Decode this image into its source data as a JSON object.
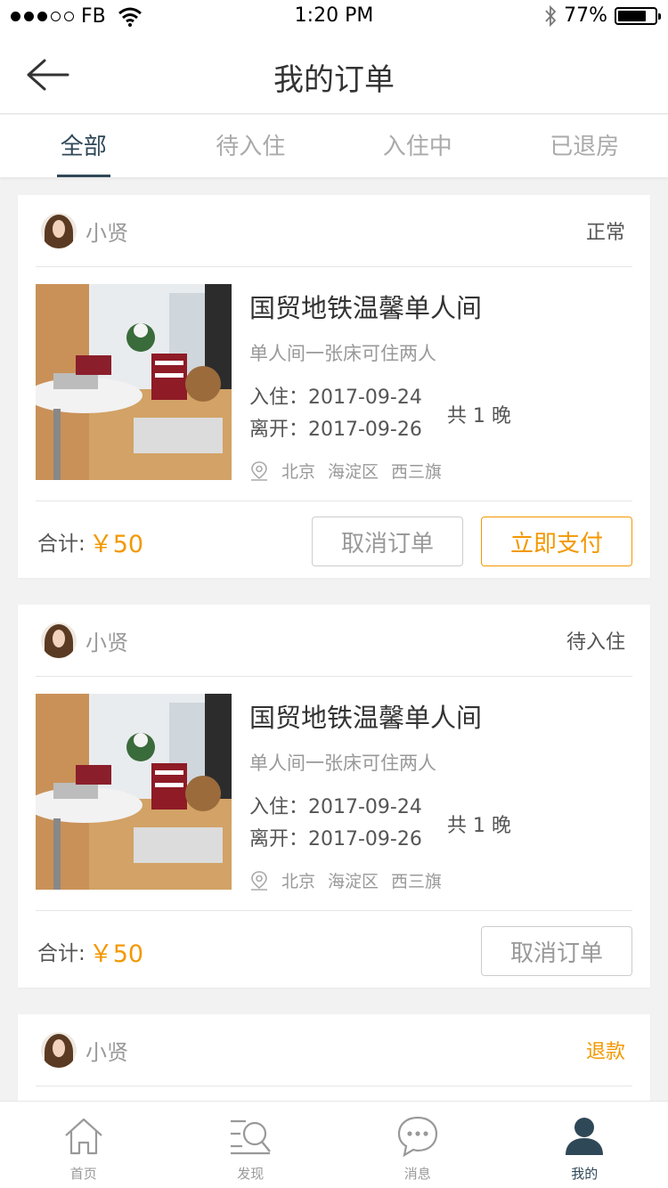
{
  "status_bar": {
    "carrier": "FB",
    "time": "1:20 PM",
    "battery": "77%",
    "battery_level": 0.77
  },
  "nav": {
    "title": "我的订单"
  },
  "tabs": [
    {
      "label": "全部"
    },
    {
      "label": "待入住"
    },
    {
      "label": "入住中"
    },
    {
      "label": "已退房"
    }
  ],
  "orders": [
    {
      "host": "小贤",
      "status": "正常",
      "title": "国贸地铁温馨单人间",
      "subtitle": "单人间一张床可住两人",
      "checkin": "入住：2017-09-24",
      "checkout": "离开：2017-09-26",
      "nights": "共 1 晚",
      "location": [
        "北京",
        "海淀区",
        "西三旗"
      ],
      "total_label": "合计:",
      "total": "￥50",
      "cancel_label": "取消订单",
      "pay_label": "立即支付"
    },
    {
      "host": "小贤",
      "status": "待入住",
      "title": "国贸地铁温馨单人间",
      "subtitle": "单人间一张床可住两人",
      "checkin": "入住：2017-09-24",
      "checkout": "离开：2017-09-26",
      "nights": "共 1 晚",
      "location": [
        "北京",
        "海淀区",
        "西三旗"
      ],
      "total_label": "合计:",
      "total": "￥50",
      "cancel_label": "取消订单"
    },
    {
      "host": "小贤",
      "status": "退款"
    }
  ],
  "tabbar": [
    {
      "label": "首页",
      "icon": "home-icon"
    },
    {
      "label": "发现",
      "icon": "discover-icon"
    },
    {
      "label": "消息",
      "icon": "message-icon"
    },
    {
      "label": "我的",
      "icon": "profile-icon"
    }
  ],
  "colors": {
    "accent": "#f39800",
    "active": "#2f4858",
    "muted": "#999999"
  }
}
